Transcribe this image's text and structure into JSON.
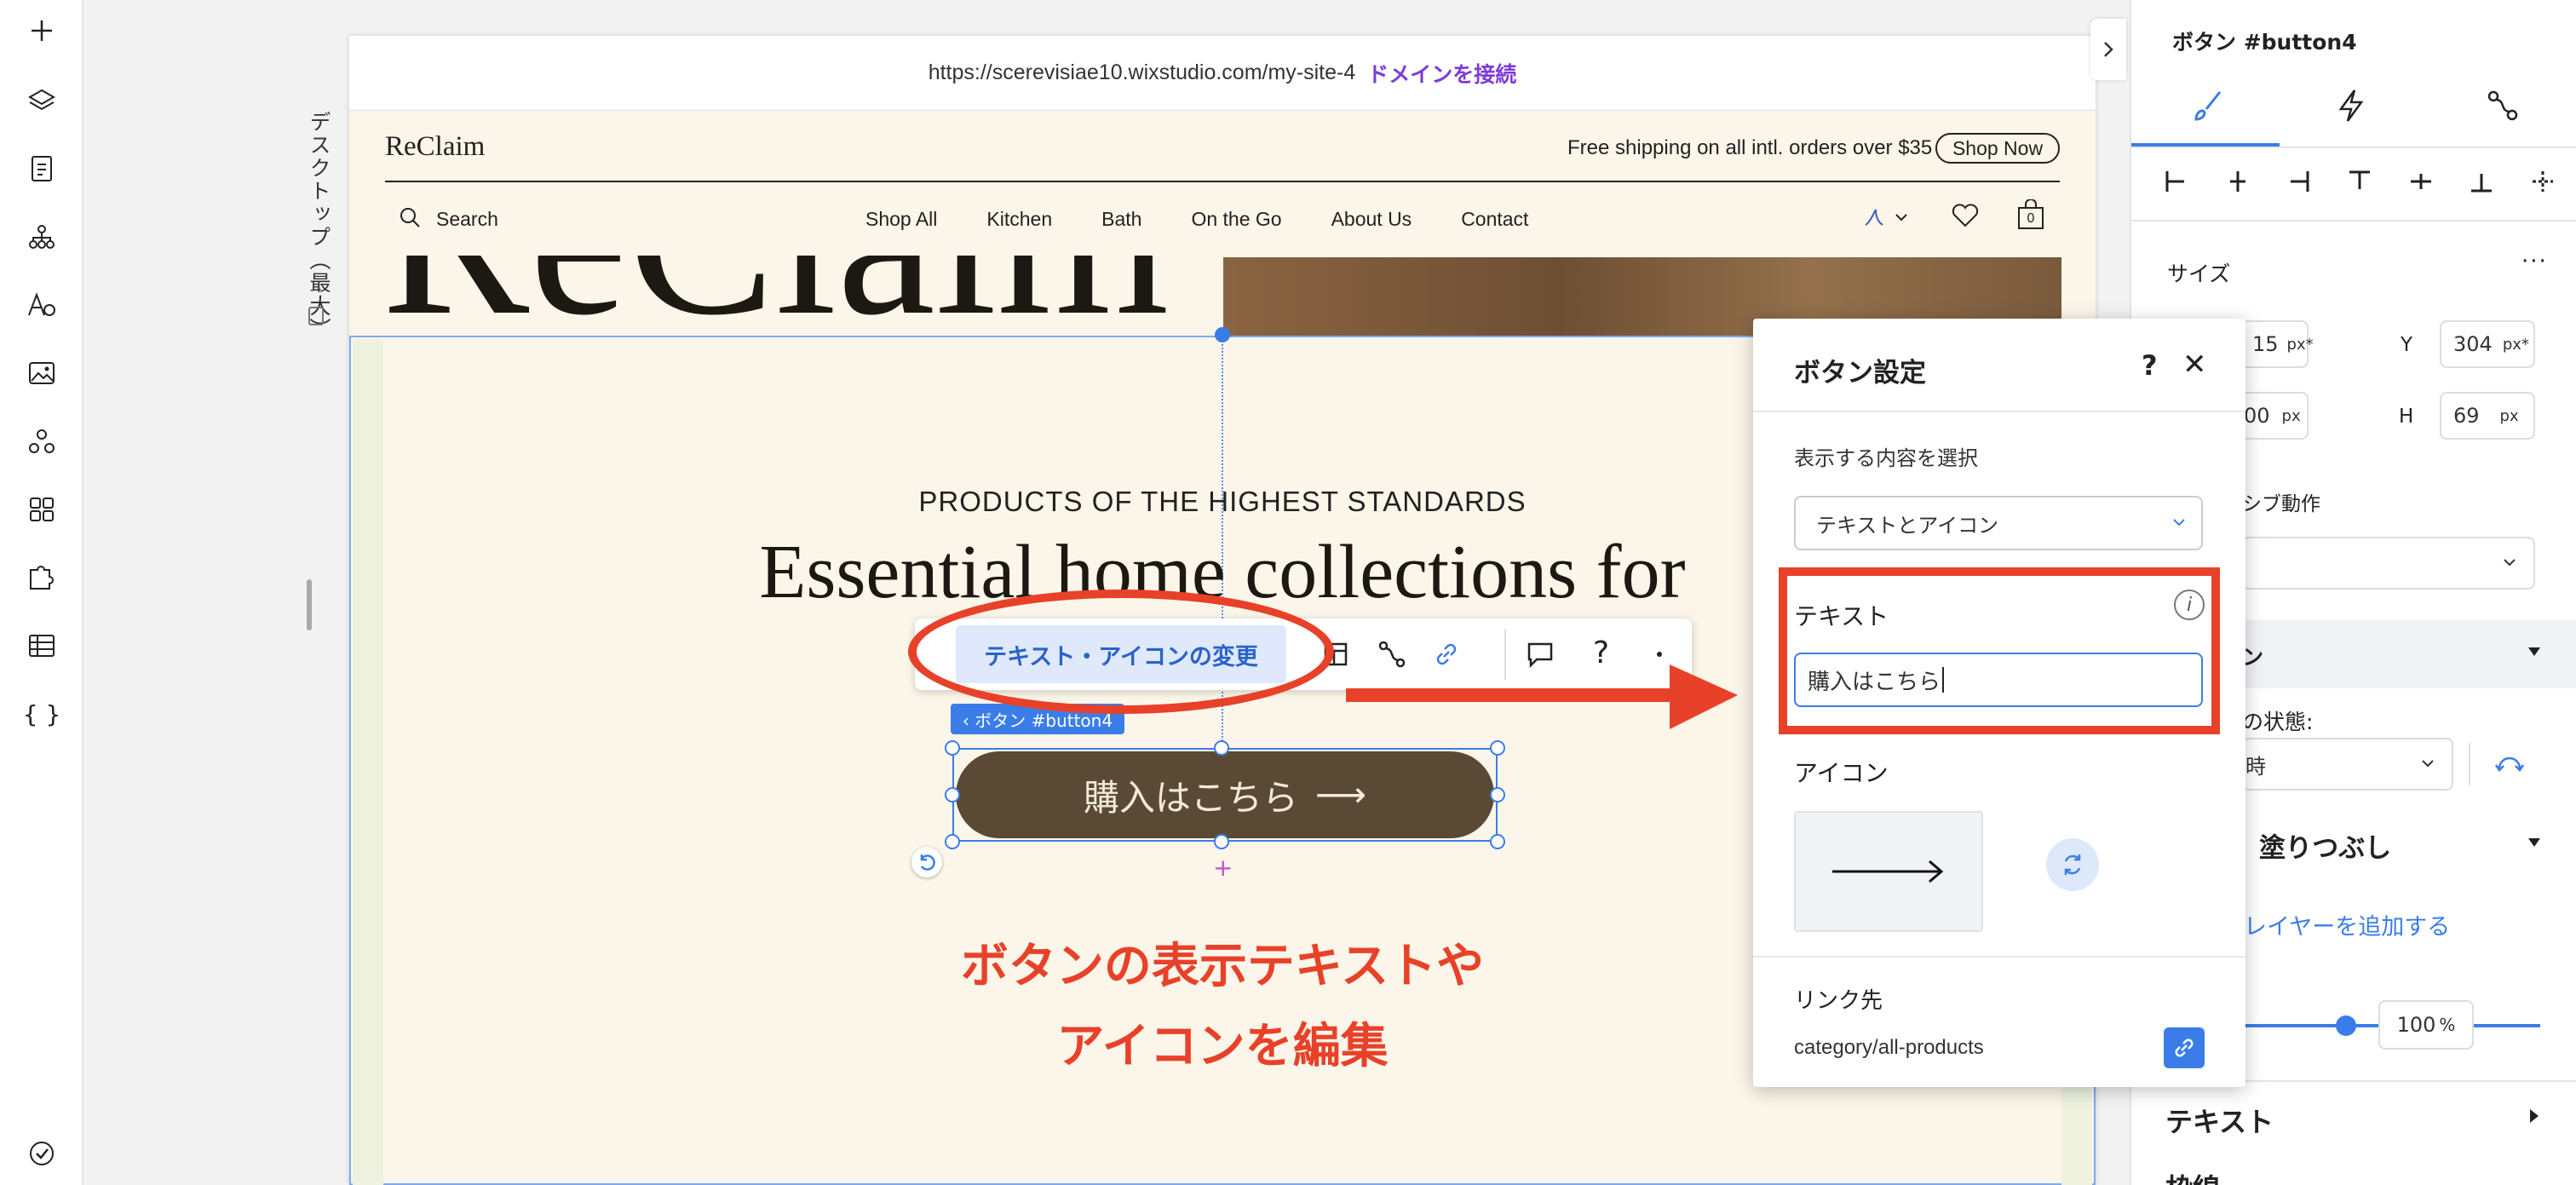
{
  "left_toolbar": {
    "icons": [
      "add-icon",
      "layers-icon",
      "pages-icon",
      "sitemap-icon",
      "text-theme-icon",
      "media-icon",
      "apps-icon",
      "widgets-icon",
      "puzzle-icon",
      "table-icon",
      "code-icon",
      "checkmark-icon"
    ]
  },
  "canvas": {
    "device_label": "デスクトップ（最大）",
    "url": "https://scerevisiae10.wixstudio.com/my-site-4",
    "connect_domain": "ドメインを接続"
  },
  "site": {
    "logo": "ReClaim",
    "promo": "Free shipping on all intl. orders over $35",
    "shop_now": "Shop Now",
    "search": "Search",
    "nav": [
      "Shop All",
      "Kitchen",
      "Bath",
      "On the Go",
      "About Us",
      "Contact"
    ],
    "cart_count": "0",
    "hero_big": "ReClaim",
    "eyebrow": "PRODUCTS OF THE HIGHEST STANDARDS",
    "headline": "Essential home collections for",
    "button_label": "購入はこちら",
    "button_arrow": "⟶"
  },
  "floating_toolbar": {
    "change_label": "テキスト・アイコンの変更",
    "element_tag": "‹ ボタン #button4",
    "help": "?"
  },
  "annotation": {
    "line1": "ボタンの表示テキストや",
    "line2": "アイコンを編集"
  },
  "popup": {
    "title": "ボタン設定",
    "help": "?",
    "close": "✕",
    "display_label": "表示する内容を選択",
    "display_value": "テキストとアイコン",
    "text_label": "テキスト",
    "text_value": "購入はこちら",
    "icon_label": "アイコン",
    "link_label": "リンク先",
    "link_value": "category/all-products"
  },
  "inspector": {
    "title": "ボタン #button4",
    "size_label": "サイズ",
    "x_value": "15",
    "y_label": "Y",
    "y_value": "304",
    "w_value": "00",
    "h_label": "H",
    "h_value": "69",
    "unit_px_star": "px*",
    "unit_px": "px",
    "responsive_label": "シブ動作",
    "section_label": "ン",
    "state_label": "の状態:",
    "state_value": "時",
    "fill_label": "塗りつぶし",
    "add_layer": "レイヤーを追加する",
    "opacity_value": "100",
    "opacity_unit": "%",
    "text_section": "テキスト",
    "border_section": "枠線"
  },
  "colors": {
    "accent_blue": "#3b7de8",
    "annotation_red": "#e8412a",
    "button_brown": "#5a4a35",
    "page_bg": "#fbf6e9",
    "domain_purple": "#7d3bd9"
  }
}
